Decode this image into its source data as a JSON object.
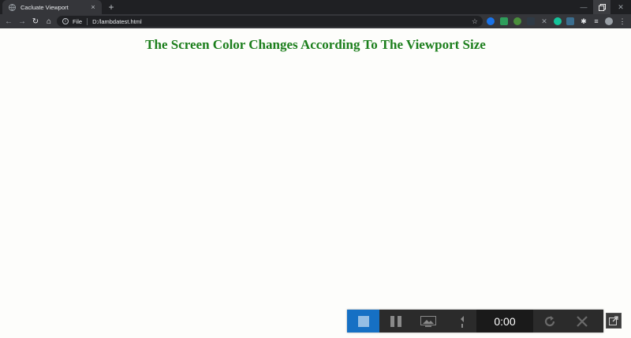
{
  "browser": {
    "tab_title": "Cacluate Viewport",
    "tab_close": "×",
    "new_tab": "+",
    "window": {
      "minimize": "—",
      "close": "✕"
    },
    "address": {
      "scheme": "File",
      "url": "D:/lambdatest.html"
    }
  },
  "page": {
    "heading": "The Screen Color Changes According To The Viewport Size",
    "heading_color": "#1b7e1b",
    "background": "#fdfdfb"
  },
  "recorder": {
    "timer": "0:00",
    "accent": "#1670c4"
  }
}
